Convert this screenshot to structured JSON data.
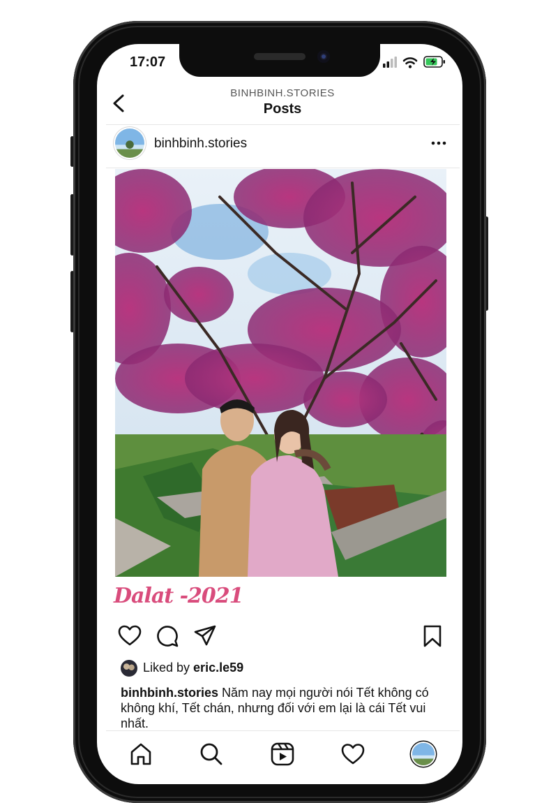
{
  "status_bar": {
    "time": "17:07"
  },
  "header": {
    "account": "BINHBINH.STORIES",
    "title": "Posts"
  },
  "post": {
    "username": "binhbinh.stories",
    "photo_overlay_text": "Dalat -2021",
    "liked_by_prefix": "Liked by ",
    "liked_by_user": "eric.le59",
    "caption_user": "binhbinh.stories",
    "caption_text": " Năm nay mọi người nói Tết không có không khí, Tết chán, nhưng đối với em lại là cái Tết vui nhất."
  },
  "icons": {
    "back": "chevron-left-icon",
    "more": "more-horizontal-icon",
    "like": "heart-icon",
    "comment": "comment-icon",
    "share": "send-icon",
    "save": "bookmark-icon",
    "home": "home-icon",
    "search": "search-icon",
    "reels": "reels-icon",
    "activity": "heart-icon"
  },
  "colors": {
    "caption_accent": "#d94c7c",
    "battery": "#34c759"
  }
}
